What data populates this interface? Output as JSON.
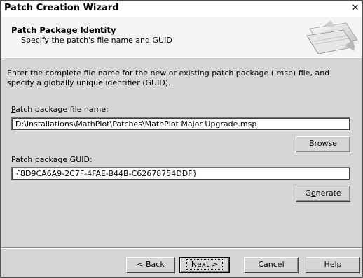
{
  "window": {
    "title": "Patch Creation Wizard",
    "close_glyph": "✕"
  },
  "header": {
    "title": "Patch Package Identity",
    "subtitle": "Specify the patch's file name and GUID"
  },
  "description": "Enter the complete file name for the new or existing patch package (.msp) file, and specify a globally unique identifier (GUID).",
  "file_field": {
    "label_mnemonic": "P",
    "label_rest": "atch package file name:",
    "value": "D:\\Installations\\MathPlot\\Patches\\MathPlot Major Upgrade.msp"
  },
  "browse_button": {
    "mnemonic": "r",
    "pre": "B",
    "post": "owse"
  },
  "guid_field": {
    "label_pre": "Patch package ",
    "label_mnemonic": "G",
    "label_post": "UID:",
    "value": "{8D9CA6A9-2C7F-4FAE-B44B-C62678754DDF}"
  },
  "generate_button": {
    "pre": "G",
    "mnemonic": "e",
    "post": "nerate"
  },
  "footer": {
    "back": {
      "pre": "< ",
      "mnemonic": "B",
      "post": "ack"
    },
    "next": {
      "pre": "",
      "mnemonic": "N",
      "post": "ext >"
    },
    "cancel": "Cancel",
    "help": "Help"
  }
}
